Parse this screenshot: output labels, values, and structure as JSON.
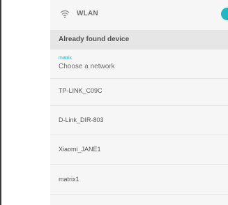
{
  "wlan": {
    "label": "WLAN",
    "icon": "wifi-icon",
    "toggle_on": true,
    "accent": "#1fb8c4"
  },
  "section": {
    "title": "Already found device"
  },
  "current": {
    "name": "matrix",
    "subtitle": "Choose a network"
  },
  "networks": [
    {
      "name": "TP-LINK_C09C"
    },
    {
      "name": "D-Link_DIR-803"
    },
    {
      "name": "Xiaomi_JANE1"
    },
    {
      "name": "matrix1"
    }
  ]
}
